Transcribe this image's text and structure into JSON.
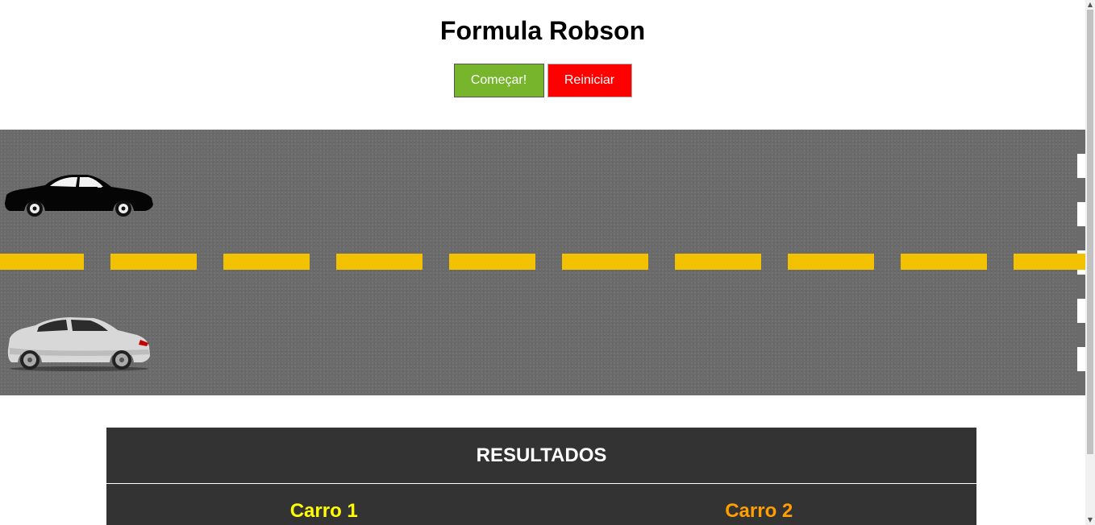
{
  "header": {
    "title": "Formula Robson"
  },
  "controls": {
    "start_label": "Começar!",
    "restart_label": "Reiniciar",
    "start_color": "#76b52c",
    "restart_color": "#ff0000"
  },
  "race": {
    "car1": {
      "icon": "black-sedan-car",
      "progress": 0
    },
    "car2": {
      "icon": "silver-suv-car",
      "progress": 0
    },
    "lane_divider_color": "#f2c200",
    "road_color": "#6b6b6b"
  },
  "results": {
    "heading": "RESULTADOS",
    "car1_label": "Carro 1",
    "car2_label": "Carro 2",
    "car1_color": "#ffff00",
    "car2_color": "#ff9f00"
  }
}
